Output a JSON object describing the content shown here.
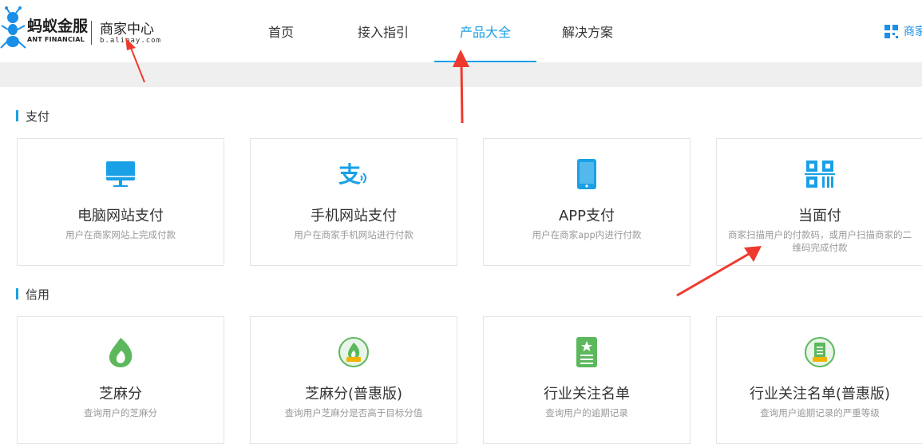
{
  "header": {
    "logo_name": "蚂蚁金服",
    "logo_sub": "ANT FINANCIAL",
    "logo_center": "商家中心",
    "logo_domain": "b.alipay.com",
    "right_link": "商家"
  },
  "nav": {
    "items": [
      {
        "label": "首页"
      },
      {
        "label": "接入指引"
      },
      {
        "label": "产品大全"
      },
      {
        "label": "解决方案"
      }
    ],
    "active": "产品大全"
  },
  "sections": [
    {
      "title": "支付",
      "cards": [
        {
          "title": "电脑网站支付",
          "desc": "用户在商家网站上完成付款",
          "icon": "monitor-icon"
        },
        {
          "title": "手机网站支付",
          "desc": "用户在商家手机网站进行付款",
          "icon": "alipay-wave-icon"
        },
        {
          "title": "APP支付",
          "desc": "用户在商家app内进行付款",
          "icon": "phone-icon"
        },
        {
          "title": "当面付",
          "desc": "商家扫描用户的付款码，或用户扫描商家的二维码完成付款",
          "icon": "scan-code-icon"
        }
      ]
    },
    {
      "title": "信用",
      "cards": [
        {
          "title": "芝麻分",
          "desc": "查询用户的芝麻分",
          "icon": "sesame-icon"
        },
        {
          "title": "芝麻分(普惠版)",
          "desc": "查询用户芝麻分是否高于目标分值",
          "icon": "sesame-badge-icon"
        },
        {
          "title": "行业关注名单",
          "desc": "查询用户的逾期记录",
          "icon": "watchlist-icon"
        },
        {
          "title": "行业关注名单(普惠版)",
          "desc": "查询用户逾期记录的严重等级",
          "icon": "watchlist-badge-icon"
        }
      ]
    }
  ],
  "colors": {
    "accent": "#1aa0e6",
    "sesame_green": "#5cb85c",
    "annotation_red": "#ee3a2e"
  }
}
